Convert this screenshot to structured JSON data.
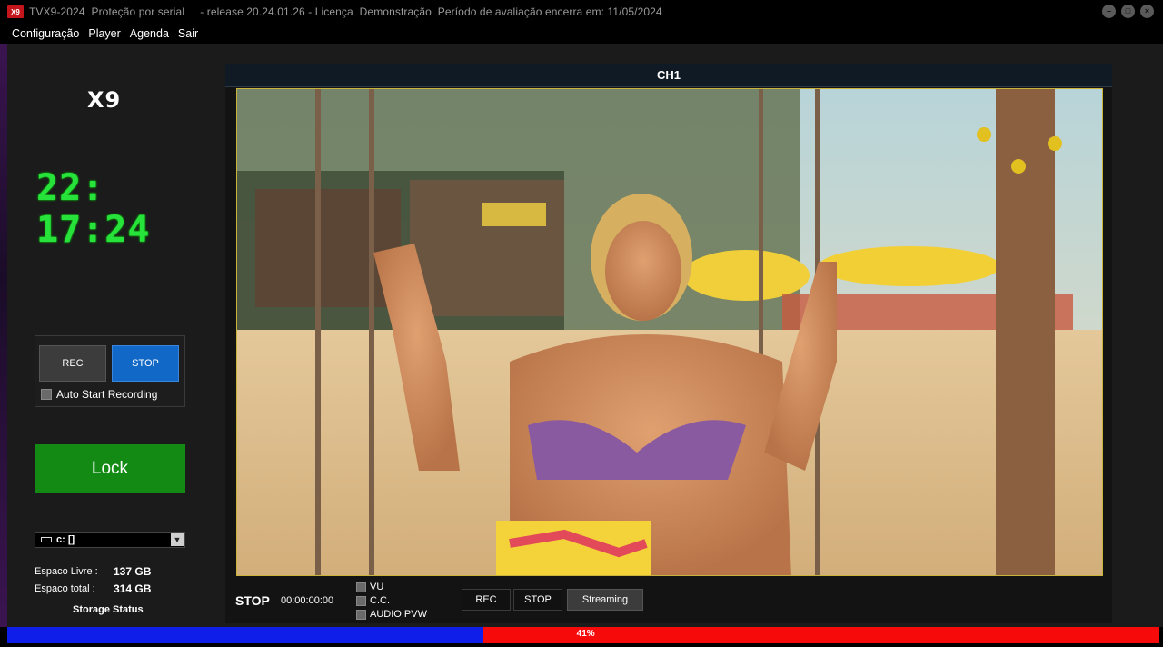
{
  "window": {
    "title": "TVX9-2024  Proteção por serial     - release 20.24.01.26 - Licença  Demonstração  Período de avaliação encerra em: 11/05/2024",
    "app_icon_text": "X9"
  },
  "menu": [
    "Configuração",
    "Player",
    "Agenda",
    "Sair"
  ],
  "sidebar": {
    "logo": "X9",
    "clock": "22: 17:24",
    "rec_label": "REC",
    "stop_label": "STOP",
    "auto_start_label": "Auto Start Recording",
    "lock_label": "Lock",
    "drive": "c: []",
    "free_label": "Espaco Livre :",
    "free_value": "137 GB",
    "total_label": "Espaco total :",
    "total_value": "314 GB",
    "storage_status_label": "Storage Status"
  },
  "channel": {
    "title": "CH1",
    "state": "STOP",
    "time": "00:00:00:00",
    "options": [
      "VU",
      "C.C.",
      "AUDIO PVW"
    ],
    "rec_label": "REC",
    "stop_label": "STOP",
    "streaming_label": "Streaming"
  },
  "storage_bar": {
    "label": "41%",
    "used_fraction": 0.41,
    "used_color": "#f60a0a",
    "free_color": "#0f1ee8"
  }
}
